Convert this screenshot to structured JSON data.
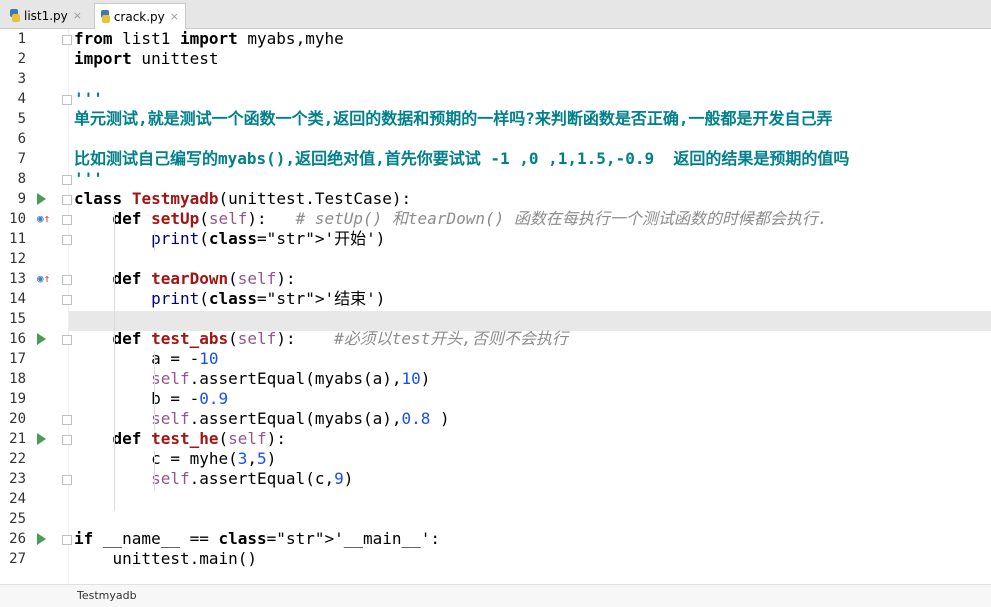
{
  "tabs": [
    {
      "label": "list1.py",
      "close": "×"
    },
    {
      "label": "crack.py",
      "close": "×"
    }
  ],
  "code_lines": [
    {
      "n": "1",
      "t": "from list1 import myabs,myhe"
    },
    {
      "n": "2",
      "t": "import unittest"
    },
    {
      "n": "3",
      "t": ""
    },
    {
      "n": "4",
      "t": "'''"
    },
    {
      "n": "5",
      "t": "单元测试,就是测试一个函数一个类,返回的数据和预期的一样吗?来判断函数是否正确,一般都是开发自己弄"
    },
    {
      "n": "6",
      "t": ""
    },
    {
      "n": "7",
      "t": "比如测试自己编写的myabs(),返回绝对值,首先你要试试 -1 ,0 ,1,1.5,-0.9  返回的结果是预期的值吗"
    },
    {
      "n": "8",
      "t": "'''"
    },
    {
      "n": "9",
      "t": "class Testmyadb(unittest.TestCase):"
    },
    {
      "n": "10",
      "t": "    def setUp(self):   # setUp() 和tearDown() 函数在每执行一个测试函数的时候都会执行."
    },
    {
      "n": "11",
      "t": "        print('开始')"
    },
    {
      "n": "12",
      "t": ""
    },
    {
      "n": "13",
      "t": "    def tearDown(self):"
    },
    {
      "n": "14",
      "t": "        print('结束')"
    },
    {
      "n": "15",
      "t": ""
    },
    {
      "n": "16",
      "t": "    def test_abs(self):    #必须以test开头,否则不会执行"
    },
    {
      "n": "17",
      "t": "        a = -10"
    },
    {
      "n": "18",
      "t": "        self.assertEqual(myabs(a),10)"
    },
    {
      "n": "19",
      "t": "        b = -0.9"
    },
    {
      "n": "20",
      "t": "        self.assertEqual(myabs(a),0.8 )"
    },
    {
      "n": "21",
      "t": "    def test_he(self):"
    },
    {
      "n": "22",
      "t": "        c = myhe(3,5)"
    },
    {
      "n": "23",
      "t": "        self.assertEqual(c,9)"
    },
    {
      "n": "24",
      "t": ""
    },
    {
      "n": "25",
      "t": ""
    },
    {
      "n": "26",
      "t": "if __name__ == '__main__':"
    },
    {
      "n": "27",
      "t": "    unittest.main()"
    }
  ],
  "gutter_icons": {
    "run": [
      "9",
      "16",
      "21",
      "26"
    ],
    "override": [
      "10",
      "13"
    ]
  },
  "status_bar": {
    "breadcrumb": "Testmyadb"
  },
  "colors": {
    "keyword": "#000000",
    "string": "#008080",
    "comment": "#8c8c8c",
    "number": "#1750eb",
    "self": "#94558d",
    "highlight_line": "#e8e8e8"
  }
}
